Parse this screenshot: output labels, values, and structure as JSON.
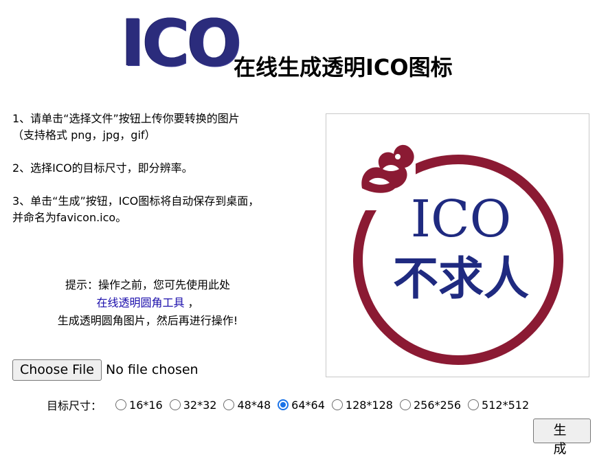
{
  "header": {
    "logo_text": "ICO",
    "title": "在线生成透明ICO图标"
  },
  "instructions": {
    "step1_line1": "1、请单击“选择文件”按钮上传你要转换的图片",
    "step1_line2": "（支持格式 png，jpg，gif）",
    "step2": "2、选择ICO的目标尺寸，即分辨率。",
    "step3_line1": "3、单击“生成”按钮，ICO图标将自动保存到桌面，",
    "step3_line2": "并命名为favicon.ico。"
  },
  "tip": {
    "line1": "提示：操作之前，您可先使用此处",
    "link": "在线透明圆角工具",
    "link_suffix": " ，",
    "line3": "生成透明圆角图片，然后再进行操作!"
  },
  "preview": {
    "line1": "ICO",
    "line2": "不求人",
    "ring_color": "#8b1a33",
    "text_color": "#1f2a80"
  },
  "file_input": {
    "button_label": "Choose File",
    "status": "No file chosen"
  },
  "size_selector": {
    "label": "目标尺寸：",
    "options": [
      "16*16",
      "32*32",
      "48*48",
      "64*64",
      "128*128",
      "256*256",
      "512*512"
    ],
    "selected": "64*64"
  },
  "actions": {
    "generate_label": "生成"
  },
  "colors": {
    "link": "#1a0dab",
    "logo": "#2b2c7c",
    "radio_checked": "#1a73e8"
  }
}
